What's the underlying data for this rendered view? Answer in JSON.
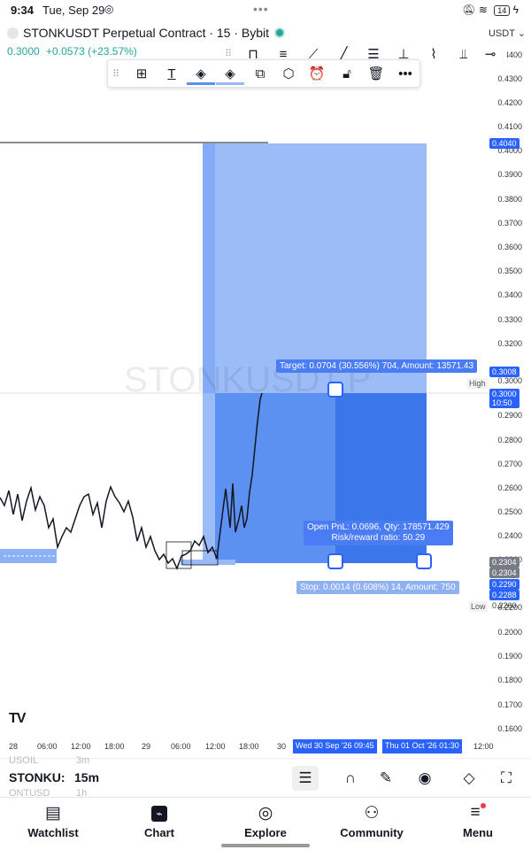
{
  "status": {
    "time": "9:34",
    "date": "Tue, Sep 29",
    "battery": "14"
  },
  "header": {
    "symbol": "STONKUSDT Perpetual Contract · 15 · Bybit",
    "price": "0.3000",
    "change": "+0.0573 (+23.57%)",
    "currency": "USDT"
  },
  "watermark": "STONKUSDT.P",
  "price_axis": [
    "0.4400",
    "0.4300",
    "0.4200",
    "0.4100",
    "0.4000",
    "0.3900",
    "0.3800",
    "0.3700",
    "0.3600",
    "0.3500",
    "0.3400",
    "0.3300",
    "0.3200",
    "0.3000",
    "0.2900",
    "0.2800",
    "0.2700",
    "0.2600",
    "0.2500",
    "0.2400",
    "0.2300",
    "0.2200",
    "0.2000",
    "0.1900",
    "0.1800",
    "0.1700",
    "0.1600"
  ],
  "price_tags": {
    "target_price": "0.4040",
    "high_price": "0.3008",
    "high_label": "High",
    "current_price": "0.3000",
    "countdown": "10:50",
    "entry_price": "0.2304",
    "entry_price2": "0.2304",
    "stop_price": "0.2290",
    "stop_price2": "0.2288",
    "low_price": "0.2260",
    "low_label": "Low"
  },
  "time_axis": [
    "28",
    "06:00",
    "12:00",
    "18:00",
    "29",
    "06:00",
    "12:00",
    "18:00",
    "30",
    "12:00"
  ],
  "time_range": {
    "start": "Wed 30 Sep '26  09:45",
    "end": "Thu 01 Oct '26  01:30"
  },
  "position": {
    "target": "Target: 0.0704 (30.556%) 704, Amount: 13571.43",
    "pnl": "Open PnL: 0.0696, Qty: 178571.429",
    "rr": "Risk/reward ratio: 50.29",
    "stop": "Stop: 0.0014 (0.608%) 14, Amount: 750"
  },
  "watchlist_peek": {
    "symbol": "STONKU:",
    "interval": "15m",
    "prev": "USOIL",
    "prev_iv": "3m",
    "next": "ONTUSD",
    "next_iv": "1h"
  },
  "nav": {
    "watchlist": "Watchlist",
    "chart": "Chart",
    "explore": "Explore",
    "community": "Community",
    "menu": "Menu"
  },
  "colors": {
    "accent": "#2962ff",
    "up": "#26a69a",
    "zone_fill": "#5b8ff0"
  }
}
